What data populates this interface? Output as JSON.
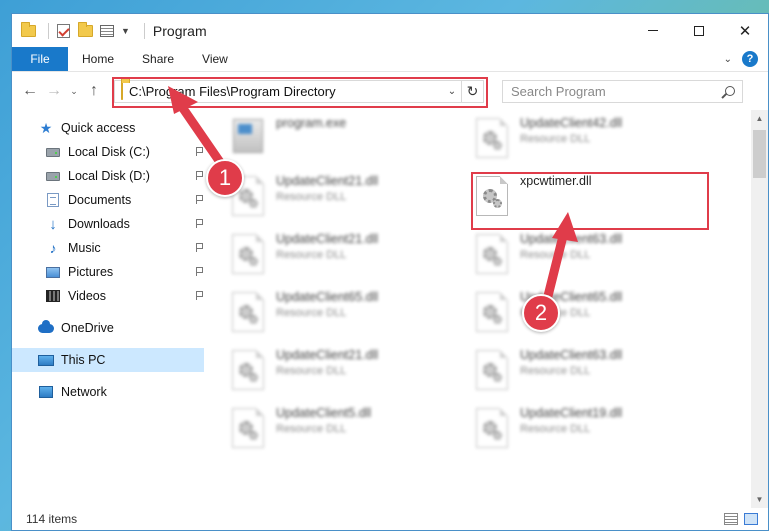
{
  "window": {
    "title": "Program"
  },
  "ribbon": {
    "file": "File",
    "tabs": [
      "Home",
      "Share",
      "View"
    ]
  },
  "address": {
    "path": "C:\\Program Files\\Program Directory"
  },
  "search": {
    "placeholder": "Search Program"
  },
  "nav": {
    "quick_access": "Quick access",
    "items": [
      {
        "label": "Local Disk (C:)",
        "icon": "drive-icon",
        "pinned": true
      },
      {
        "label": "Local Disk (D:)",
        "icon": "drive-icon",
        "pinned": true
      },
      {
        "label": "Documents",
        "icon": "documents-icon",
        "pinned": true
      },
      {
        "label": "Downloads",
        "icon": "downloads-icon",
        "pinned": true
      },
      {
        "label": "Music",
        "icon": "music-icon",
        "pinned": true
      },
      {
        "label": "Pictures",
        "icon": "pictures-icon",
        "pinned": true
      },
      {
        "label": "Videos",
        "icon": "videos-icon",
        "pinned": true
      }
    ],
    "onedrive": "OneDrive",
    "this_pc": "This PC",
    "network": "Network"
  },
  "files": [
    {
      "name": "program.exe",
      "type": "",
      "col": 0,
      "row": 0,
      "blurred": true,
      "kind": "exe"
    },
    {
      "name": "UpdateClient42.dll",
      "type": "Resource DLL",
      "col": 1,
      "row": 0,
      "blurred": true,
      "kind": "dll"
    },
    {
      "name": "UpdateClient21.dll",
      "type": "Resource DLL",
      "col": 0,
      "row": 1,
      "blurred": true,
      "kind": "dll"
    },
    {
      "name": "xpcwtimer.dll",
      "type": "",
      "col": 1,
      "row": 1,
      "blurred": false,
      "kind": "dll"
    },
    {
      "name": "UpdateClient21.dll",
      "type": "Resource DLL",
      "col": 0,
      "row": 2,
      "blurred": true,
      "kind": "dll"
    },
    {
      "name": "UpdateClient63.dll",
      "type": "Resource DLL",
      "col": 1,
      "row": 2,
      "blurred": true,
      "kind": "dll"
    },
    {
      "name": "UpdateClient65.dll",
      "type": "Resource DLL",
      "col": 0,
      "row": 3,
      "blurred": true,
      "kind": "dll"
    },
    {
      "name": "UpdateClient65.dll",
      "type": "Resource DLL",
      "col": 1,
      "row": 3,
      "blurred": true,
      "kind": "dll"
    },
    {
      "name": "UpdateClient21.dll",
      "type": "Resource DLL",
      "col": 0,
      "row": 4,
      "blurred": true,
      "kind": "dll"
    },
    {
      "name": "UpdateClient63.dll",
      "type": "Resource DLL",
      "col": 1,
      "row": 4,
      "blurred": true,
      "kind": "dll"
    },
    {
      "name": "UpdateClient5.dll",
      "type": "Resource DLL",
      "col": 0,
      "row": 5,
      "blurred": true,
      "kind": "dll"
    },
    {
      "name": "UpdateClient19.dll",
      "type": "Resource DLL",
      "col": 1,
      "row": 5,
      "blurred": true,
      "kind": "dll"
    }
  ],
  "status": {
    "items": "114 items"
  },
  "annotations": {
    "step1": "1",
    "step2": "2",
    "color": "#e03c4a"
  }
}
